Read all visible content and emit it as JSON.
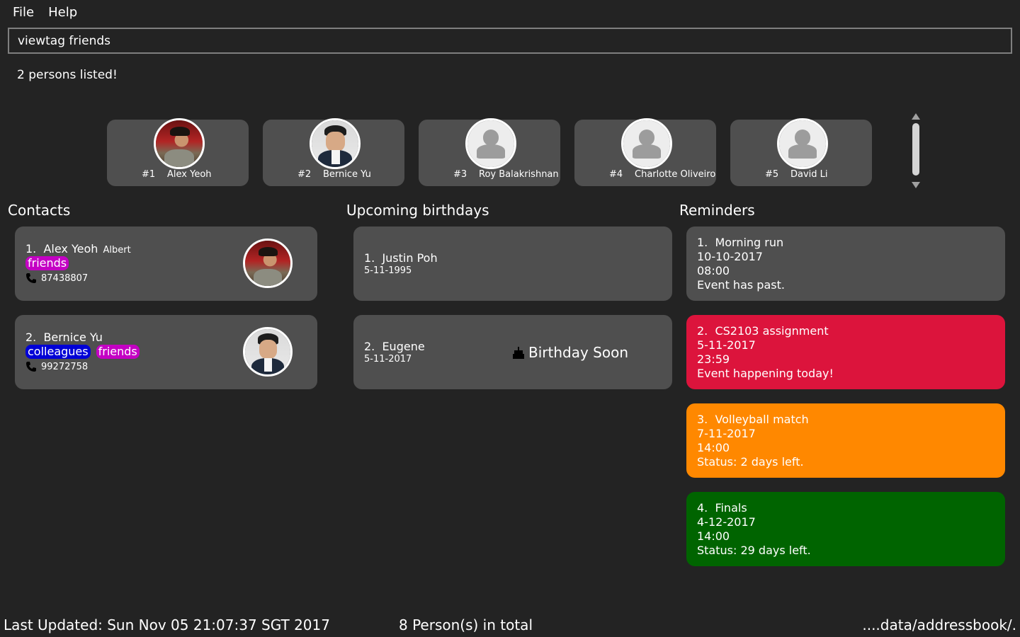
{
  "menu": {
    "file": "File",
    "help": "Help"
  },
  "command": {
    "value": "viewtag friends"
  },
  "result": "2 persons listed!",
  "strip": [
    {
      "index": "#1",
      "name": "Alex Yeoh"
    },
    {
      "index": "#2",
      "name": "Bernice Yu"
    },
    {
      "index": "#3",
      "name": "Roy Balakrishnan"
    },
    {
      "index": "#4",
      "name": "Charlotte Oliveiro"
    },
    {
      "index": "#5",
      "name": "David Li"
    }
  ],
  "sections": {
    "contacts": "Contacts",
    "birthdays": "Upcoming birthdays",
    "reminders": "Reminders"
  },
  "contacts": [
    {
      "index": "1.",
      "name": "Alex Yeoh",
      "nickname": "Albert",
      "tags": [
        "friends"
      ],
      "phone": "87438807"
    },
    {
      "index": "2.",
      "name": "Bernice Yu",
      "nickname": "",
      "tags": [
        "colleagues",
        "friends"
      ],
      "phone": "99272758"
    }
  ],
  "tag_colors": {
    "friends": "#c400c4",
    "colleagues": "#0000d6"
  },
  "birthdays": [
    {
      "index": "1.",
      "name": "Justin Poh",
      "date": "5-11-1995",
      "badge": ""
    },
    {
      "index": "2.",
      "name": "Eugene",
      "date": "5-11-2017",
      "badge": "Birthday Soon"
    }
  ],
  "reminders": [
    {
      "index": "1.",
      "title": "Morning run",
      "date": "10-10-2017",
      "time": "08:00",
      "status": "Event has past.",
      "color": "#4f4f4f"
    },
    {
      "index": "2.",
      "title": "CS2103 assignment",
      "date": "5-11-2017",
      "time": "23:59",
      "status": "Event happening today!",
      "color": "#dc143c"
    },
    {
      "index": "3.",
      "title": "Volleyball match",
      "date": "7-11-2017",
      "time": "14:00",
      "status": "Status: 2 days left.",
      "color": "#ff8800"
    },
    {
      "index": "4.",
      "title": "Finals",
      "date": "4-12-2017",
      "time": "14:00",
      "status": "Status: 29 days left.",
      "color": "#006400"
    }
  ],
  "status_bar": {
    "last_updated": "Last Updated: Sun Nov 05 21:07:37 SGT 2017",
    "total": "8 Person(s) in total",
    "path": "....data/addressbook/."
  },
  "colors": {
    "background": "#232323",
    "card": "#4f4f4f"
  }
}
